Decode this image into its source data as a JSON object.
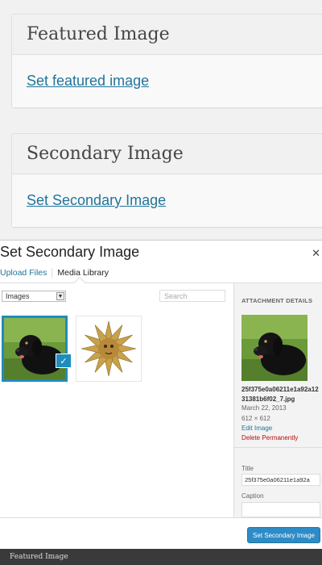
{
  "metaboxes": {
    "featured": {
      "title": "Featured Image",
      "link": "Set featured image"
    },
    "secondary": {
      "title": "Secondary Image",
      "link": "Set Secondary Image"
    }
  },
  "modal": {
    "title": "Set Secondary Image",
    "close_icon": "close-x",
    "tabs": [
      {
        "label": "Upload Files"
      },
      {
        "label": "Media Library"
      }
    ],
    "filter": {
      "selected": "Images"
    },
    "search": {
      "placeholder": "Search"
    },
    "thumbnails": [
      {
        "alt": "black dog on grass",
        "selected": true
      },
      {
        "alt": "golden star flower",
        "selected": false
      }
    ],
    "details": {
      "heading": "ATTACHMENT DETAILS",
      "filename": "25f375e0a06211e1a92a1231381b6f02_7.jpg",
      "date": "March 22, 2013",
      "dimensions": "612 × 612",
      "edit": "Edit Image",
      "delete": "Delete Permanently",
      "title_label": "Title",
      "title_value": "25f375e0a06211e1a92a",
      "caption_label": "Caption"
    },
    "primary_button": "Set Secondary Image"
  },
  "bottom_bar": {
    "label": "Featured Image"
  },
  "colors": {
    "link": "#21759b",
    "accent": "#1e8cbe",
    "button": "#2e8bc6",
    "danger": "#bc0b0b"
  }
}
